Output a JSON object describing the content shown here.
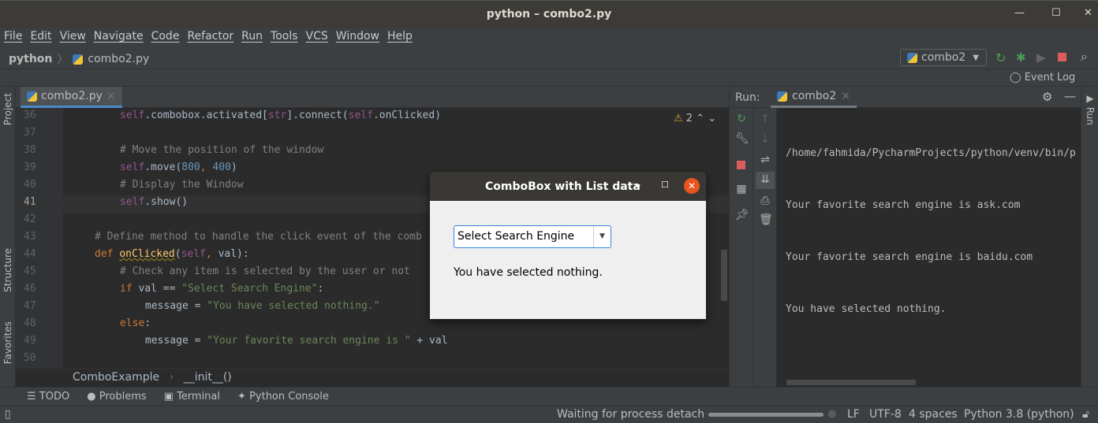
{
  "window": {
    "title": "python – combo2.py"
  },
  "menu": [
    "File",
    "Edit",
    "View",
    "Navigate",
    "Code",
    "Refactor",
    "Run",
    "Tools",
    "VCS",
    "Window",
    "Help"
  ],
  "nav": {
    "project": "python",
    "file": "combo2.py",
    "run_config": "combo2",
    "event_log": "Event Log"
  },
  "editor": {
    "tab": "combo2.py",
    "warnings": "2",
    "current_line": 41,
    "lines": [
      {
        "n": "36",
        "indent": 2,
        "tokens": [
          [
            "self",
            "sf"
          ],
          [
            ".combobox.activated[",
            ""
          ],
          [
            "str",
            "sf"
          ],
          [
            "].connect(",
            ""
          ],
          [
            "self",
            "sf"
          ],
          [
            ".onClicked)",
            ""
          ]
        ]
      },
      {
        "n": "37",
        "indent": 0,
        "tokens": []
      },
      {
        "n": "38",
        "indent": 2,
        "tokens": [
          [
            "# Move the position of the window",
            "cm"
          ]
        ]
      },
      {
        "n": "39",
        "indent": 2,
        "tokens": [
          [
            "self",
            "sf"
          ],
          [
            ".move(",
            ""
          ],
          [
            "800",
            "nm"
          ],
          [
            ", ",
            "kw"
          ],
          [
            "400",
            "nm"
          ],
          [
            ")",
            ""
          ]
        ]
      },
      {
        "n": "40",
        "indent": 2,
        "tokens": [
          [
            "# Display the Window",
            "cm"
          ]
        ]
      },
      {
        "n": "41",
        "indent": 2,
        "tokens": [
          [
            "self",
            "sf"
          ],
          [
            ".show()",
            ""
          ]
        ]
      },
      {
        "n": "42",
        "indent": 0,
        "tokens": []
      },
      {
        "n": "43",
        "indent": 1,
        "tokens": [
          [
            "# Define method to handle the click event of the comb",
            "cm"
          ]
        ]
      },
      {
        "n": "44",
        "indent": 1,
        "tokens": [
          [
            "def ",
            "kw"
          ],
          [
            "onClicked",
            "fn"
          ],
          [
            "(",
            ""
          ],
          [
            "self",
            "sf"
          ],
          [
            ", ",
            "kw"
          ],
          [
            "val):",
            ""
          ]
        ]
      },
      {
        "n": "45",
        "indent": 2,
        "tokens": [
          [
            "# Check any item is selected by the user or not",
            "cm"
          ]
        ]
      },
      {
        "n": "46",
        "indent": 2,
        "tokens": [
          [
            "if ",
            "kw"
          ],
          [
            "val == ",
            ""
          ],
          [
            "\"Select Search Engine\"",
            "st"
          ],
          [
            ":",
            ""
          ]
        ]
      },
      {
        "n": "47",
        "indent": 3,
        "tokens": [
          [
            "message = ",
            ""
          ],
          [
            "\"You have selected nothing.\"",
            "st"
          ]
        ]
      },
      {
        "n": "48",
        "indent": 2,
        "tokens": [
          [
            "else",
            "kw"
          ],
          [
            ":",
            ""
          ]
        ]
      },
      {
        "n": "49",
        "indent": 3,
        "tokens": [
          [
            "message = ",
            ""
          ],
          [
            "\"Your favorite search engine is \"",
            "st"
          ],
          [
            " + val",
            ""
          ]
        ]
      },
      {
        "n": "50",
        "indent": 0,
        "tokens": []
      }
    ],
    "breadcrumb": [
      "ComboExample",
      "__init__()"
    ]
  },
  "side_tabs": {
    "project": "Project",
    "structure": "Structure",
    "favorites": "Favorites",
    "run": "Run"
  },
  "run": {
    "label": "Run:",
    "tab": "combo2",
    "output": [
      "/home/fahmida/PycharmProjects/python/venv/bin/p",
      "Your favorite search engine is ask.com",
      "Your favorite search engine is baidu.com",
      "You have selected nothing."
    ]
  },
  "bottom_tabs": [
    "TODO",
    "Problems",
    "Terminal",
    "Python Console"
  ],
  "status": {
    "message": "Waiting for process detach",
    "line_sep": "LF",
    "encoding": "UTF-8",
    "indent": "4 spaces",
    "interpreter": "Python 3.8 (python)"
  },
  "dialog": {
    "title": "ComboBox with List data",
    "combo_value": "Select Search Engine",
    "message": "You have selected nothing."
  },
  "colors": {
    "accent": "#4a88c7",
    "stop": "#db5c5c",
    "run": "#499c54",
    "dialog_close": "#e95420"
  }
}
